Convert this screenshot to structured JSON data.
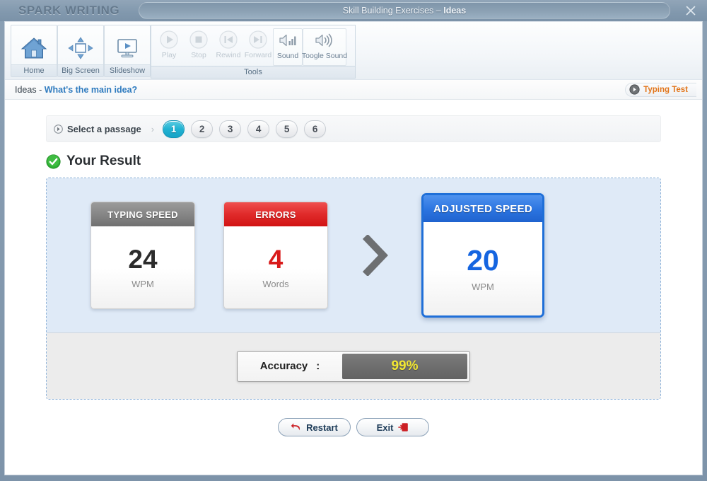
{
  "window": {
    "logo": "SPARK WRITING",
    "title_main": "Skill Building Exercises",
    "title_dash": "–",
    "title_sub": "Ideas",
    "close_label": "close-icon"
  },
  "ribbon": {
    "buttons": [
      {
        "label": "Home",
        "icon": "home-icon"
      },
      {
        "label": "Big Screen",
        "icon": "big-screen-icon"
      },
      {
        "label": "Slideshow",
        "icon": "slideshow-icon"
      }
    ],
    "tools_group_label": "Tools",
    "tools": [
      {
        "label": "Play",
        "icon": "play-icon",
        "disabled": true,
        "boxed": false
      },
      {
        "label": "Stop",
        "icon": "stop-icon",
        "disabled": true,
        "boxed": false
      },
      {
        "label": "Rewind",
        "icon": "rewind-icon",
        "disabled": true,
        "boxed": false
      },
      {
        "label": "Forward",
        "icon": "forward-icon",
        "disabled": true,
        "boxed": false
      },
      {
        "label": "Sound",
        "icon": "sound-bars-icon",
        "disabled": false,
        "boxed": true
      },
      {
        "label": "Toogle Sound",
        "icon": "speaker-waves-icon",
        "disabled": false,
        "boxed": true
      }
    ]
  },
  "breadcrumb": {
    "category": "Ideas",
    "separator": " - ",
    "topic": "What's the main idea?",
    "typing_test_label": "Typing Test",
    "typing_test_icon": "circle-arrow-icon"
  },
  "passages": {
    "select_label": "Select a passage",
    "select_icon": "circle-play-icon",
    "chevron": "›",
    "items": [
      "1",
      "2",
      "3",
      "4",
      "5",
      "6"
    ],
    "active": "1"
  },
  "result": {
    "heading": "Your Result",
    "heading_icon": "green-check-icon",
    "cards": [
      {
        "title": "TYPING SPEED",
        "value": "24",
        "unit": "WPM",
        "accent": "#707070"
      },
      {
        "title": "ERRORS",
        "value": "4",
        "unit": "Words",
        "accent": "#d11414"
      }
    ],
    "arrow_icon": "chevron-right-icon",
    "highlight_card": {
      "title": "ADJUSTED SPEED",
      "value": "20",
      "unit": "WPM",
      "accent": "#1f6fd8"
    },
    "accuracy_label": "Accuracy",
    "accuracy_colon": ":",
    "accuracy_value": "99%"
  },
  "actions": {
    "restart_label": "Restart",
    "restart_icon": "undo-arrow-icon",
    "exit_label": "Exit",
    "exit_icon": "exit-door-icon"
  },
  "colors": {
    "accent_blue": "#1f6fd8",
    "error_red": "#d11414",
    "accuracy_yellow": "#f2e733",
    "active_pill": "#22b3d3",
    "typing_test_orange": "#e2751a",
    "panel_blue": "#dfeaf7"
  }
}
